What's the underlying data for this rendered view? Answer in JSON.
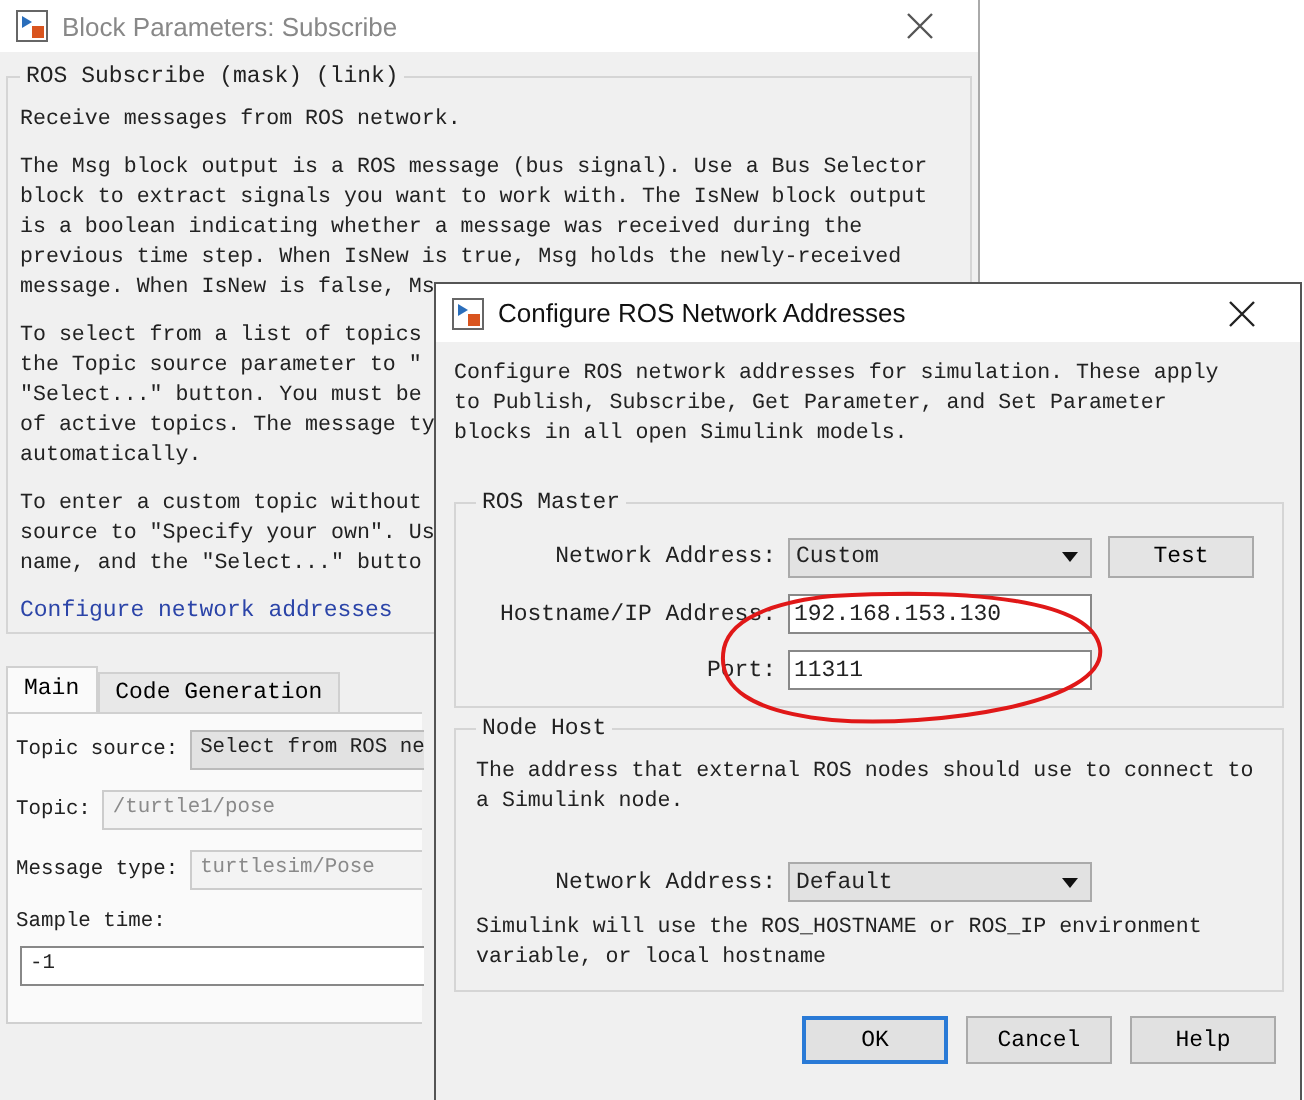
{
  "block_window": {
    "title": "Block Parameters: Subscribe",
    "mask_title": "ROS Subscribe (mask) (link)",
    "paragraphs": [
      [
        "Receive messages from ROS network."
      ],
      [
        "The Msg block output is a ROS message (bus signal). Use a Bus Selector",
        "block to extract signals you want to work with. The IsNew block output",
        "is a boolean indicating whether a message was received during the",
        "previous time step. When IsNew is true, Msg holds the newly-received",
        "message. When IsNew is false, Ms"
      ],
      [
        "To select from a list of topics",
        "the Topic source parameter to ″",
        "″Select...″ button. You must be",
        "of active topics. The message ty",
        "automatically."
      ],
      [
        "To enter a custom topic without",
        "source to ″Specify your own″. Us",
        "name, and the ″Select...″ butto"
      ]
    ],
    "link": "Configure network addresses",
    "tabs": [
      {
        "label": "Main",
        "selected": true
      },
      {
        "label": "Code Generation",
        "selected": false
      }
    ],
    "parameters": [
      {
        "kind": "dropdown",
        "label": "Topic source:",
        "value": "Select from ROS ne",
        "disabled": false
      },
      {
        "kind": "field",
        "label": "Topic:",
        "value": "/turtle1/pose",
        "disabled": true
      },
      {
        "kind": "field",
        "label": "Message type:",
        "value": "turtlesim/Pose",
        "disabled": true
      },
      {
        "kind": "stacked",
        "label": "Sample time:",
        "value": "-1",
        "disabled": false
      }
    ]
  },
  "dialog": {
    "title": "Configure ROS Network Addresses",
    "description": "Configure ROS network addresses for simulation. These apply to Publish, Subscribe, Get Parameter, and Set Parameter blocks in all open Simulink models.",
    "ros_master": {
      "legend": "ROS Master",
      "network_address": {
        "label": "Network Address:",
        "value": "Custom"
      },
      "test_button": "Test",
      "hostname": {
        "label": "Hostname/IP Address:",
        "value": "192.168.153.130"
      },
      "port": {
        "label": "Port:",
        "value": "11311"
      }
    },
    "node_host": {
      "legend": "Node Host",
      "description": "The address that external ROS nodes should use to connect to a Simulink node.",
      "network_address": {
        "label": "Network Address:",
        "value": "Default"
      },
      "note": "Simulink will use the ROS_HOSTNAME or ROS_IP environment variable, or local hostname"
    },
    "buttons": [
      {
        "label": "OK",
        "focused": true
      },
      {
        "label": "Cancel",
        "focused": false
      },
      {
        "label": "Help",
        "focused": false
      }
    ]
  }
}
